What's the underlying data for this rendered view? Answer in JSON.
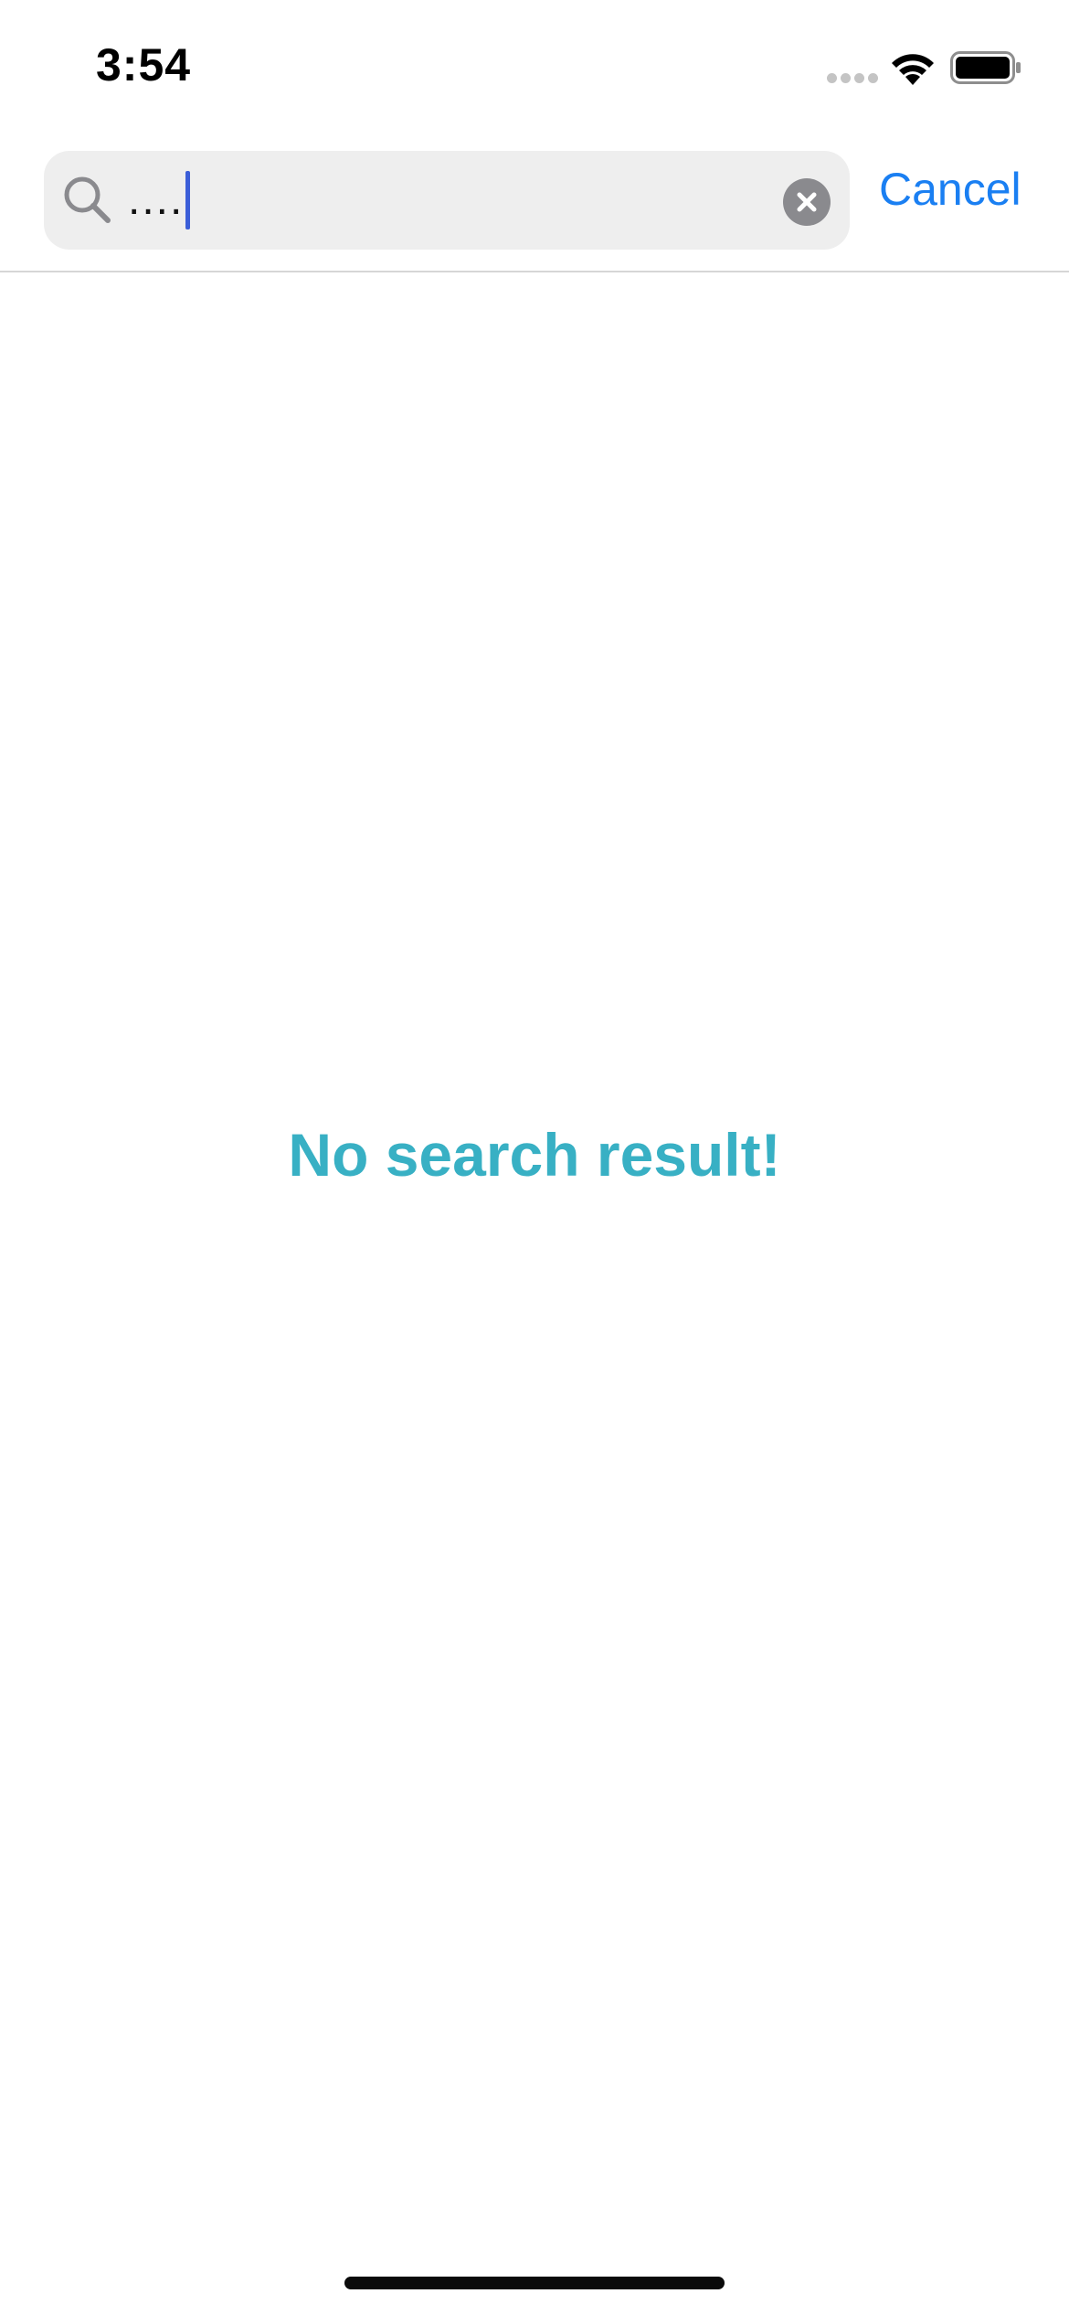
{
  "status_bar": {
    "time": "3:54"
  },
  "search": {
    "value": "....",
    "clear_icon": "clear-circle-icon",
    "search_icon": "magnifier-icon",
    "cancel_label": "Cancel"
  },
  "results": {
    "empty_message": "No search result!"
  },
  "colors": {
    "accent": "#1a7ff2",
    "empty_message": "#38b0c4",
    "caret": "#3b5ed8",
    "field_background": "#eeeeee"
  }
}
